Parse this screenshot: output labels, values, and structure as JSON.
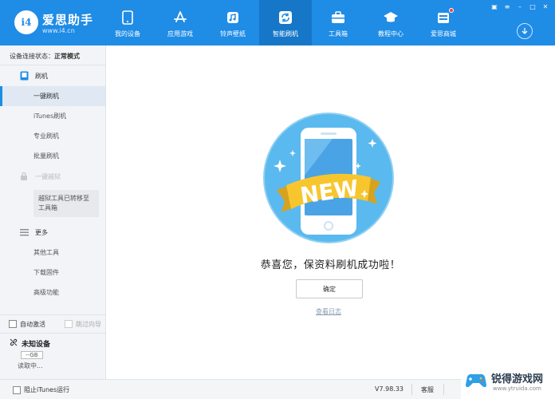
{
  "brand": {
    "logo": "i4",
    "name": "爱思助手",
    "url": "www.i4.cn"
  },
  "nav": [
    {
      "label": "我的设备",
      "icon": "phone-icon"
    },
    {
      "label": "应用游戏",
      "icon": "app-store-icon"
    },
    {
      "label": "铃声壁纸",
      "icon": "music-icon"
    },
    {
      "label": "智能刷机",
      "icon": "refresh-icon",
      "active": true
    },
    {
      "label": "工具箱",
      "icon": "toolbox-icon"
    },
    {
      "label": "教程中心",
      "icon": "graduation-cap-icon"
    },
    {
      "label": "爱思商城",
      "icon": "shop-icon",
      "badge": true
    }
  ],
  "sidebar": {
    "status_label": "设备连接状态：",
    "status_value": "正常模式",
    "flash_section": "刷机",
    "flash_items": [
      "一键刷机",
      "iTunes刷机",
      "专业刷机",
      "批量刷机"
    ],
    "jailbreak_section": "一键越狱",
    "jailbreak_note": "越狱工具已转移至工具箱",
    "more_section": "更多",
    "more_items": [
      "其他工具",
      "下载固件",
      "高级功能"
    ],
    "auto_activate": "自动激活",
    "skip_guide": "跳过向导",
    "device_name": "未知设备",
    "device_storage": "--GB",
    "device_status": "读取中..."
  },
  "main": {
    "hero_text": "NEW",
    "success_message": "恭喜您，保资料刷机成功啦！",
    "confirm_button": "确定",
    "view_log_link": "查看日志"
  },
  "footer": {
    "block_itunes": "阻止iTunes运行",
    "version": "V7.98.33",
    "service": "客服"
  },
  "watermark": {
    "name": "锐得游戏网",
    "url": "www.ytruida.com"
  },
  "colors": {
    "primary": "#1f8ce6",
    "hero_bg": "#5ab9ee",
    "ribbon": "#f7c62f"
  }
}
